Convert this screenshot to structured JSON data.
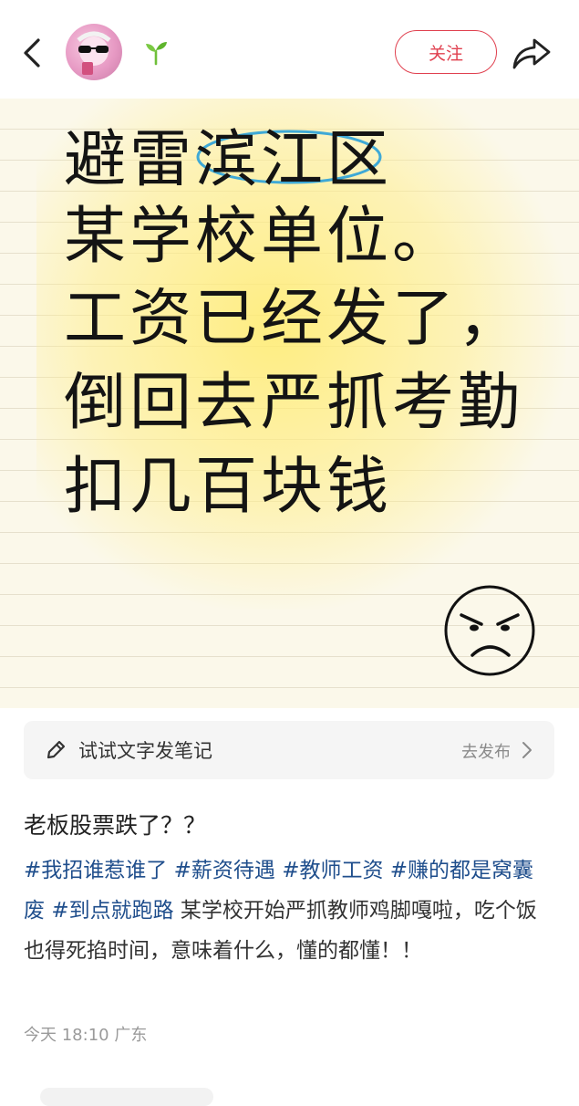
{
  "header": {
    "back_icon": "chevron-left-icon",
    "avatar": "user-avatar",
    "badge_icon": "sprout-icon",
    "follow_label": "关注",
    "share_icon": "share-icon",
    "accent_color": "#e0404f"
  },
  "note_image": {
    "lines": [
      "避雷滨江区",
      "某学校单位。",
      "工资已经发了，",
      "倒回去严抓考勤",
      "扣几百块钱"
    ],
    "decoration_icon": "angry-face-icon"
  },
  "compose": {
    "icon": "pencil-icon",
    "placeholder": "试试文字发笔记",
    "action_label": "去发布",
    "action_icon": "chevron-right-icon"
  },
  "post": {
    "title": "老板股票跌了？？",
    "hashtags": [
      "#我招谁惹谁了",
      "#薪资待遇",
      "#教师工资",
      "#赚的都是窝囊废",
      "#到点就跑路"
    ],
    "body": "某学校开始严抓教师鸡脚嘎啦，吃个饭也得死掐时间，意味着什么，懂的都懂！！",
    "time": "今天 18:10",
    "location": "广东",
    "hashtag_color": "#1f4e8c"
  }
}
